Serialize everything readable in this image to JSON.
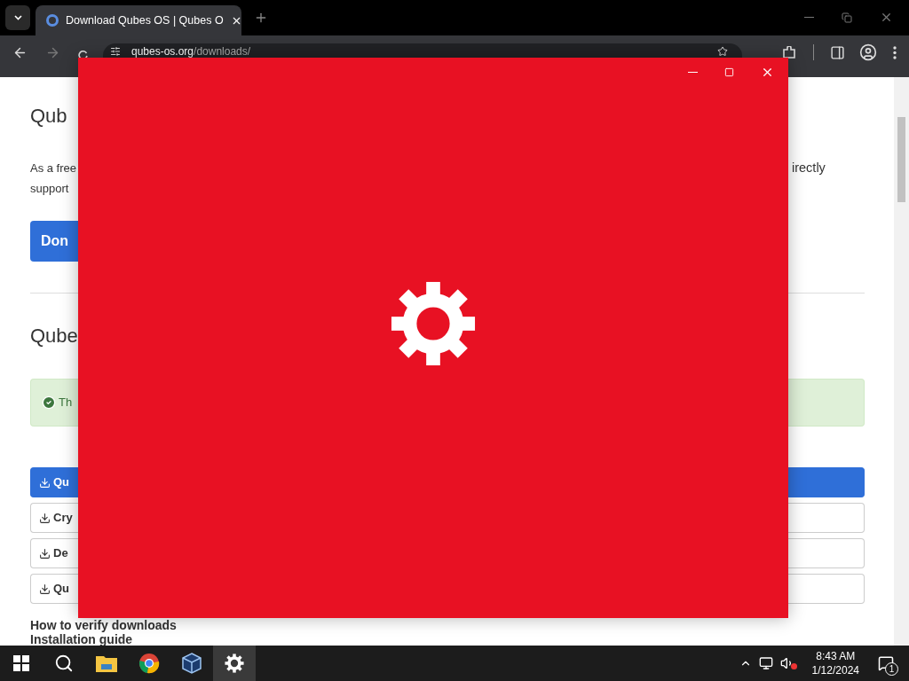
{
  "browser": {
    "tab": {
      "title": "Download Qubes OS | Qubes O"
    },
    "address": {
      "host": "qubes-os.org",
      "path": "/downloads/"
    }
  },
  "page": {
    "heading_1": "Qub",
    "paragraph_lines": [
      "As a free",
      "support"
    ],
    "paragraph_right": "irectly",
    "donate_button": "Don",
    "heading_2": "Qube",
    "alert": "Th",
    "download_buttons": [
      {
        "label": "Qu",
        "primary": true
      },
      {
        "label": "Cry",
        "primary": false
      },
      {
        "label": "De",
        "primary": false
      },
      {
        "label": "Qu",
        "primary": false
      }
    ],
    "links": [
      "How to verify downloads",
      "Installation guide"
    ]
  },
  "taskbar": {
    "apps": [
      {
        "kind": "start",
        "selected": false
      },
      {
        "kind": "search",
        "selected": false
      },
      {
        "kind": "files",
        "selected": false
      },
      {
        "kind": "chrome",
        "selected": false
      },
      {
        "kind": "cube",
        "selected": false
      },
      {
        "kind": "settings",
        "selected": true
      }
    ],
    "clock": {
      "time": "8:43 AM",
      "date": "1/12/2024"
    },
    "notifications": "1"
  }
}
